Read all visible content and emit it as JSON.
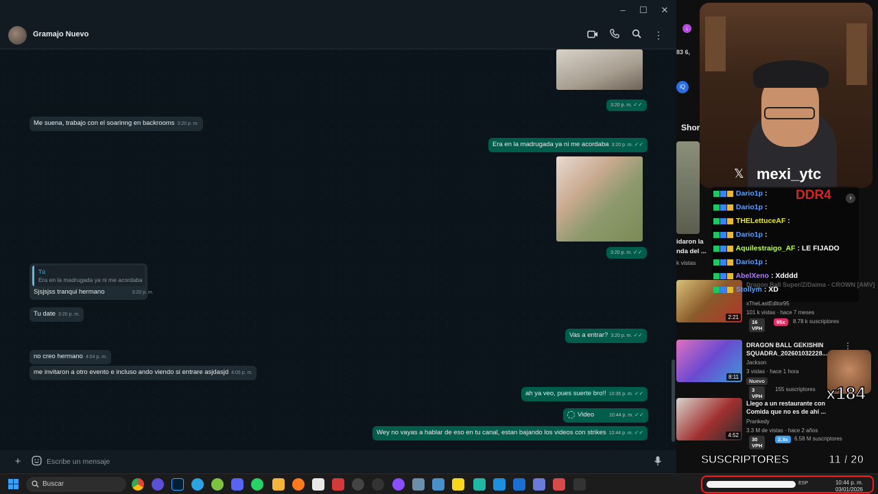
{
  "window": {
    "controls": [
      "–",
      "☐",
      "✕"
    ],
    "contact_name": "Gramajo Nuevo",
    "header_icons": [
      "video-call-icon",
      "voice-call-icon",
      "search-icon",
      "menu-icon"
    ]
  },
  "messages": [
    {
      "dir": "out",
      "type": "image",
      "time": "3:20 p. m."
    },
    {
      "dir": "in",
      "text": "Me suena, trabajo con el soarinng en backrooms",
      "time": "3:20 p. m."
    },
    {
      "dir": "out",
      "text": "Era en la madrugada ya ni me acordaba",
      "time": "3:20 p. m."
    },
    {
      "dir": "out",
      "type": "image",
      "time": "3:20 p. m."
    },
    {
      "dir": "in",
      "quote_author": "Tú",
      "quote_text": "Era en la madrugada ya ni me acordaba",
      "text": "Sjsjsjss tranqui hermano",
      "time": "3:20 p. m."
    },
    {
      "dir": "in",
      "text": "Tu date",
      "time": "3:20 p. m."
    },
    {
      "dir": "out",
      "text": "Vas a entrar?",
      "time": "3:20 p. m."
    },
    {
      "dir": "in",
      "text": "no creo hermano",
      "time": "4:04 p. m."
    },
    {
      "dir": "in",
      "text": "me invitaron a otro evento e incluso ando viendo si entrare asjdasjd",
      "time": "4:05 p. m."
    },
    {
      "dir": "out",
      "text": "ah ya veo, pues suerte bro!!",
      "time": "10:35 p. m."
    },
    {
      "dir": "out",
      "type": "video",
      "text": "Video",
      "time": "10:44 p. m."
    },
    {
      "dir": "out",
      "text": "Wey no vayas a hablar de eso en tu canal, estan bajando los videos con strikes",
      "time": "10:44 p. m."
    }
  ],
  "composer": {
    "placeholder": "Escribe un mensaje"
  },
  "stream": {
    "handle": "mexi_ytc",
    "chat": [
      {
        "user": "Dario1p",
        "msg": ":",
        "color": "#5aa0ff"
      },
      {
        "user": "Dario1p",
        "msg": ":",
        "color": "#5aa0ff"
      },
      {
        "user": "THELettuceAF",
        "msg": ":",
        "color": "#e8e83a"
      },
      {
        "user": "Dario1p",
        "msg": ":",
        "color": "#5aa0ff"
      },
      {
        "user": "Aquilestraigo_AF",
        "msg": ": LE FIJADO",
        "color": "#b9ff5a"
      },
      {
        "user": "Dario1p",
        "msg": ":",
        "color": "#5aa0ff"
      },
      {
        "user": "AbelXeno",
        "msg": ": Xdddd",
        "color": "#b07cff"
      },
      {
        "user": "Stollym",
        "msg": ": XD",
        "color": "#5aa0ff"
      }
    ],
    "overlay_text": "DDR4",
    "subs_label": "SUSCRIPTORES",
    "subs_count": "11 / 20",
    "multiplier": "x184"
  },
  "youtube": {
    "side_label": "Shor",
    "top_counter": "83  6,",
    "partial_title": "idaron la\nnda del ...",
    "partial_views": "k vistas",
    "videos": [
      {
        "title": "Dragon Ball Super/Z/Daima - CROWN [AMV]",
        "channel": "xTheLastEditor95",
        "meta": "101 k vistas · hace 7 meses",
        "duration": "2:21",
        "vph": "16 VPH",
        "x": "95x",
        "subs": "8.78 k suscriptores"
      },
      {
        "title": "DRAGON BALL GEKISHIN SQUADRA_202601032228...",
        "channel": "Jackson",
        "meta": "3 vistas · hace 1 hora",
        "duration": "8:11",
        "badge": "Nuevo",
        "vph": "3 VPH",
        "subs": "155 suscriptores"
      },
      {
        "title": "Llego a un restaurante con Comida que no es de ahí ...",
        "channel": "Prankedy",
        "meta": "3.3 M de vistas · hace 2 años",
        "duration": "4:52",
        "vph": "30 VPH",
        "x": "2.3x",
        "subs": "6.58 M suscriptores"
      }
    ]
  },
  "taskbar": {
    "search_label": "Buscar",
    "lang": "ESP",
    "time": "10:44 p. m.",
    "date": "03/01/2026"
  },
  "colors": {
    "bubble_out": "#005c4b",
    "bubble_in": "#202c33",
    "chat_bg": "#0b141a",
    "tray_highlight": "#ff1a1a"
  }
}
